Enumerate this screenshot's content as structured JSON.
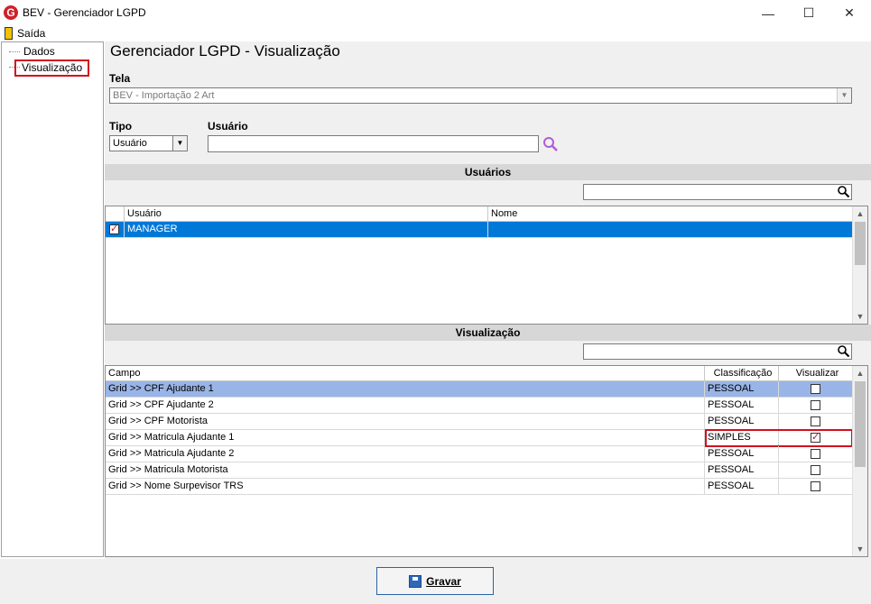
{
  "window": {
    "title": "BEV - Gerenciador LGPD",
    "logo_letter": "G",
    "minimize": "—",
    "maximize": "☐",
    "close": "✕"
  },
  "menu": {
    "exit_label": "Saída"
  },
  "tree": {
    "items": [
      "Dados",
      "Visualização"
    ],
    "selected_index": 1
  },
  "page": {
    "title": "Gerenciador LGPD - Visualização",
    "tela_label": "Tela",
    "tela_value": "BEV - Importação 2 Art",
    "tipo_label": "Tipo",
    "tipo_value": "Usuário",
    "usuario_label": "Usuário",
    "usuario_value": ""
  },
  "users_section": {
    "header": "Usuários",
    "search_value": "",
    "columns": [
      "Usuário",
      "Nome"
    ],
    "rows": [
      {
        "checked": true,
        "usuario": "MANAGER",
        "nome": "",
        "selected": true
      }
    ]
  },
  "view_section": {
    "header": "Visualização",
    "search_value": "",
    "columns": [
      "Campo",
      "Classificação",
      "Visualizar"
    ],
    "rows": [
      {
        "campo": "Grid >> CPF Ajudante 1",
        "classificacao": "PESSOAL",
        "visualizar": false,
        "selected": true
      },
      {
        "campo": "Grid >> CPF Ajudante 2",
        "classificacao": "PESSOAL",
        "visualizar": false
      },
      {
        "campo": "Grid >> CPF Motorista",
        "classificacao": "PESSOAL",
        "visualizar": false
      },
      {
        "campo": "Grid >> Matricula Ajudante 1",
        "classificacao": "SIMPLES",
        "visualizar": true,
        "highlighted": true
      },
      {
        "campo": "Grid >> Matricula Ajudante 2",
        "classificacao": "PESSOAL",
        "visualizar": false
      },
      {
        "campo": "Grid >> Matricula Motorista",
        "classificacao": "PESSOAL",
        "visualizar": false
      },
      {
        "campo": "Grid >> Nome Surpevisor TRS",
        "classificacao": "PESSOAL",
        "visualizar": false
      }
    ]
  },
  "footer": {
    "save_label": "Gravar"
  },
  "colors": {
    "selection_blue": "#0078d7",
    "selection_light": "#99b4e6",
    "highlight_red": "#d01020"
  }
}
